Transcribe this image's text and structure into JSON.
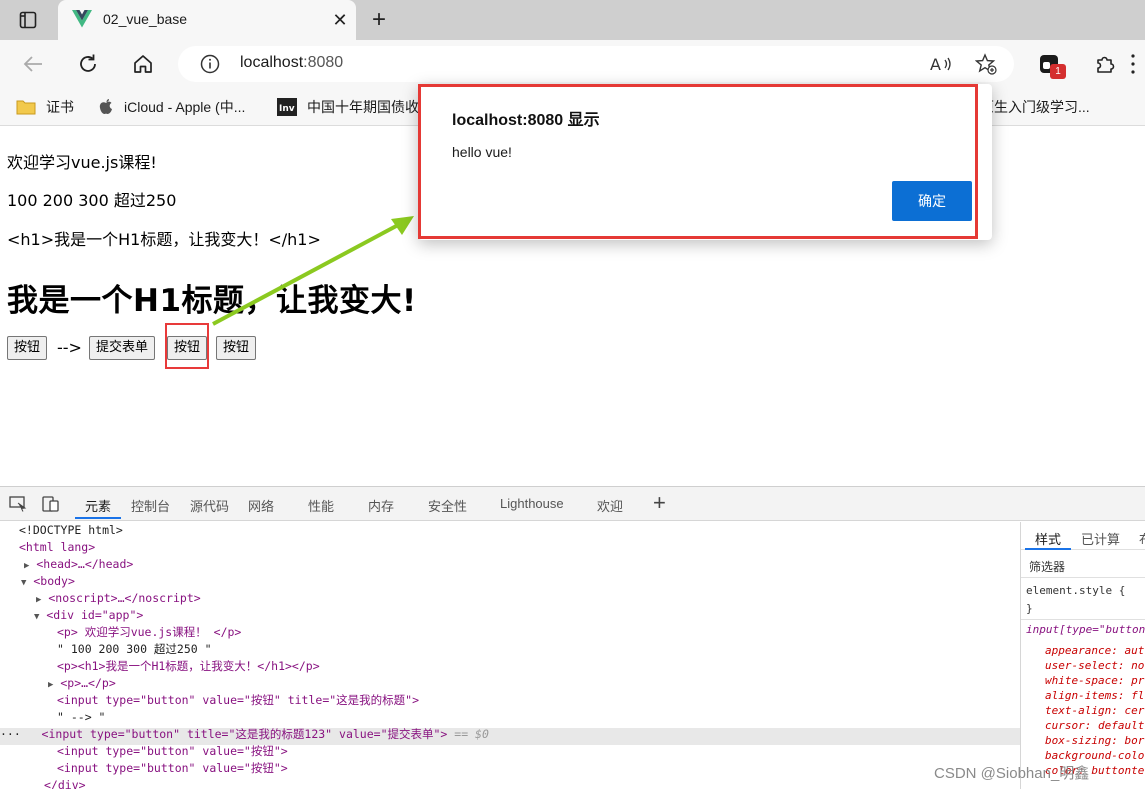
{
  "browser": {
    "tab_title": "02_vue_base",
    "url_host": "localhost",
    "url_port": ":8080",
    "extension_badge": "1",
    "bookmarks": [
      {
        "label": "证书",
        "icon": "folder-icon"
      },
      {
        "label": "iCloud - Apple (中...",
        "icon": "apple-icon"
      },
      {
        "label": "中国十年期国债收...",
        "icon": "investing-icon"
      },
      {
        "label": "原生入门级学习...",
        "icon": "bookmark-icon"
      }
    ]
  },
  "page": {
    "line1": "欢迎学习vue.js课程!",
    "line2": "100 200 300 超过250",
    "line3": "<h1>我是一个H1标题，让我变大！</h1>",
    "heading": "我是一个H1标题，让我变大!",
    "buttons": [
      "按钮",
      "提交表单",
      "按钮",
      "按钮"
    ],
    "arrow_text": "-->"
  },
  "dialog": {
    "title": "localhost:8080 显示",
    "message": "hello vue!",
    "ok_label": "确定"
  },
  "devtools": {
    "tabs": [
      "元素",
      "控制台",
      "源代码",
      "网络",
      "性能",
      "内存",
      "安全性",
      "Lighthouse",
      "欢迎"
    ],
    "dom": {
      "doctype": "<!DOCTYPE html>",
      "html_open": "<html lang>",
      "head": "<head>…</head>",
      "body_open": "<body>",
      "noscript": "<noscript>…</noscript>",
      "div_open": "<div id=\"app\">",
      "p1": "<p> 欢迎学习vue.js课程！ </p>",
      "text1": "\" 100 200 300 超过250 \"",
      "p2": "<p><h1>我是一个H1标题，让我变大！</h1></p>",
      "p3": "<p>…</p>",
      "input1": "<input type=\"button\" value=\"按钮\" title=\"这是我的标题\">",
      "text2": "\" --> \"",
      "input2": "<input type=\"button\" title=\"这是我的标题123\" value=\"提交表单\">",
      "input2_suffix": "== $0",
      "input3": "<input type=\"button\" value=\"按钮\">",
      "input4": "<input type=\"button\" value=\"按钮\">",
      "div_close": "</div>"
    },
    "styles": {
      "tabs": [
        "样式",
        "已计算",
        "布"
      ],
      "filter_placeholder": "筛选器",
      "element_style": "element.style {",
      "close_brace": "}",
      "selector": "input[type=\"button",
      "props": [
        "appearance: aut",
        "user-select: no",
        "white-space: pr",
        "align-items: fl",
        "text-align: cer",
        "cursor: default",
        "box-sizing: bor",
        "background-colo",
        "color: buttonte"
      ]
    }
  },
  "watermark": "CSDN @Siobhan_明鑫",
  "colors": {
    "dialog_button": "#0c6fd4",
    "highlight_red": "#e53935",
    "arrow_green": "#8bc920"
  }
}
